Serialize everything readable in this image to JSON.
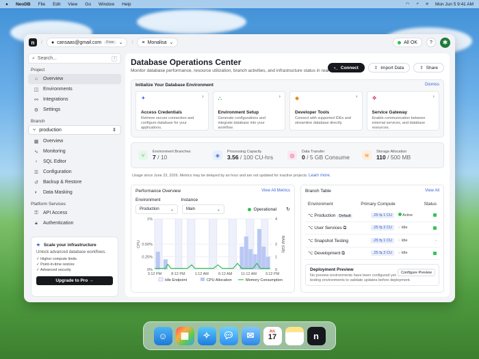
{
  "menubar": {
    "app": "NeoDB",
    "items": [
      "File",
      "Edit",
      "View",
      "Go",
      "Window",
      "Help"
    ],
    "datetime": "Mon Jun 5  9:41 AM"
  },
  "topbar": {
    "email": "cansaas@gmail.com",
    "plan": "Free",
    "project": "Monalisa",
    "status": "All OK"
  },
  "sidebar": {
    "search_placeholder": "Search...",
    "search_kbd": "/",
    "project_label": "Project",
    "project_items": [
      {
        "label": "Overview",
        "icon": "home-icon"
      },
      {
        "label": "Environments",
        "icon": "layers-icon"
      },
      {
        "label": "Integrations",
        "icon": "plug-icon"
      },
      {
        "label": "Settings",
        "icon": "gear-icon"
      }
    ],
    "branch_label": "Branch",
    "branch_value": "production",
    "branch_items": [
      {
        "label": "Overview",
        "icon": "grid-icon"
      },
      {
        "label": "Monitoring",
        "icon": "pulse-icon"
      },
      {
        "label": "SQL Editor",
        "icon": "code-icon"
      },
      {
        "label": "Configuration",
        "icon": "sliders-icon"
      },
      {
        "label": "Backup & Restore",
        "icon": "backup-icon"
      },
      {
        "label": "Data Masking",
        "icon": "mask-icon"
      }
    ],
    "platform_label": "Platform Services",
    "platform_items": [
      {
        "label": "API Access",
        "icon": "key-icon"
      },
      {
        "label": "Authentication",
        "icon": "lock-icon"
      }
    ],
    "promo": {
      "title": "Scale your infrastructure",
      "desc": "Unlock advanced database workflows.",
      "features": [
        "Higher compute limits",
        "Point-in-time restore",
        "Advanced security"
      ],
      "cta": "Upgrade to Pro"
    }
  },
  "header": {
    "title": "Database Operations Center",
    "subtitle": "Monitor database performance, resource utilization, branch activities, and infrastructure status in real time.",
    "connect": "Connect",
    "import": "Import Data",
    "share": "Share"
  },
  "init": {
    "title": "Initialize Your Database Environment",
    "dismiss": "Dismiss",
    "tiles": [
      {
        "title": "Access Credentials",
        "desc": "Retrieve secure connection and configure database for your applications."
      },
      {
        "title": "Environment Setup",
        "desc": "Generate configurations and integrate database into your workflow."
      },
      {
        "title": "Developer Tools",
        "desc": "Connect with supported IDEs and streamline database directly."
      },
      {
        "title": "Service Gateway",
        "desc": "Enable communication between external services, and database resources."
      }
    ]
  },
  "stats": [
    {
      "label": "Environment Branches",
      "value": "7",
      "unit": "/ 10",
      "color": "#e6f7ea"
    },
    {
      "label": "Processing Capacity",
      "value": "3.56",
      "unit": "/ 100 CU-hrs",
      "color": "#e7effc"
    },
    {
      "label": "Data Transfer",
      "value": "0",
      "unit": "/ 5 GB Consume",
      "color": "#fbe8f0"
    },
    {
      "label": "Storage Allocation",
      "value": "110",
      "unit": "/ 500 MB",
      "color": "#fdeede"
    }
  ],
  "usage_note": "Usage since June 23, 2026. Metrics may be delayed by an hour and are not updated for inactive projects.",
  "usage_link": "Learn more.",
  "perf": {
    "title": "Performance Overview",
    "link": "View All Metrics",
    "env_label": "Environment",
    "env_value": "Production",
    "inst_label": "Instance",
    "inst_value": "Main",
    "status": "Operational"
  },
  "chart_data": {
    "type": "bar",
    "title": "",
    "xlabel": "",
    "ylabel": "CPU",
    "y2label": "RAM (GB)",
    "yticks": [
      "1%",
      "0.50%",
      "0.25%",
      "0%"
    ],
    "y2ticks": [
      "4",
      "2",
      "1",
      "0"
    ],
    "xticks": [
      "3:12 PM",
      "8:12 PM",
      "1:12 AM",
      "6:12 AM",
      "11:12 AM",
      "3:12 PM"
    ],
    "idle_bands": [
      [
        0,
        0.35
      ],
      [
        0.95,
        1.25
      ],
      [
        1.5,
        1.85
      ],
      [
        2.5,
        2.85
      ],
      [
        3.4,
        3.75
      ],
      [
        4.2,
        4.55
      ],
      [
        4.9,
        5.2
      ]
    ],
    "series": [
      {
        "name": "Idle Endpoint",
        "values": []
      },
      {
        "name": "CPU Allocation",
        "bars": [
          [
            0.15,
            0.35
          ],
          [
            0.5,
            0.2
          ],
          [
            4.0,
            0.45
          ],
          [
            4.2,
            0.65
          ],
          [
            4.4,
            0.4
          ],
          [
            4.6,
            0.3
          ],
          [
            4.8,
            0.8
          ],
          [
            5.0,
            0.45
          ],
          [
            5.2,
            0.25
          ]
        ]
      },
      {
        "name": "Memory Consumption",
        "line": [
          [
            0,
            0.02
          ],
          [
            0.5,
            0.02
          ],
          [
            0.6,
            0.1
          ],
          [
            0.75,
            0.02
          ],
          [
            1.5,
            0.02
          ],
          [
            1.7,
            0.09
          ],
          [
            1.85,
            0.02
          ],
          [
            2.7,
            0.02
          ],
          [
            2.9,
            0.09
          ],
          [
            3.1,
            0.02
          ],
          [
            3.6,
            0.02
          ],
          [
            3.8,
            0.12
          ],
          [
            4.0,
            0.02
          ],
          [
            4.5,
            0.02
          ],
          [
            4.7,
            0.12
          ],
          [
            4.85,
            0.02
          ],
          [
            5.3,
            0.02
          ]
        ]
      }
    ],
    "x_range": [
      0,
      5.4
    ],
    "ylim": [
      0,
      1
    ],
    "legend": "bottom"
  },
  "branches": {
    "title": "Branch Table",
    "link": "View All",
    "cols": [
      "Environment",
      "Primary Compute",
      "Status"
    ],
    "rows": [
      {
        "name": "Production",
        "tag": "Default",
        "cu": ".25 ⇆ 1 CU",
        "state": "Active",
        "on": true
      },
      {
        "name": "User Services",
        "tag": "",
        "cu": ".25 ⇆ 2 CU",
        "state": "Idle",
        "on": true
      },
      {
        "name": "Snapshot Testing",
        "tag": "",
        "cu": ".25 ⇆ 1 CU",
        "state": "Idle",
        "on": false
      },
      {
        "name": "Development",
        "tag": "",
        "cu": ".25 ⇆ 2 CU",
        "state": "Idle",
        "on": true
      }
    ],
    "deploy_title": "Deployment Preview",
    "deploy_desc": "No preview environments have been configured yet. Create isolated testing environments to validate updates before deployment.",
    "deploy_btn": "Configure Preview"
  },
  "dock": {
    "calendar_month": "JUL",
    "calendar_day": "17"
  }
}
